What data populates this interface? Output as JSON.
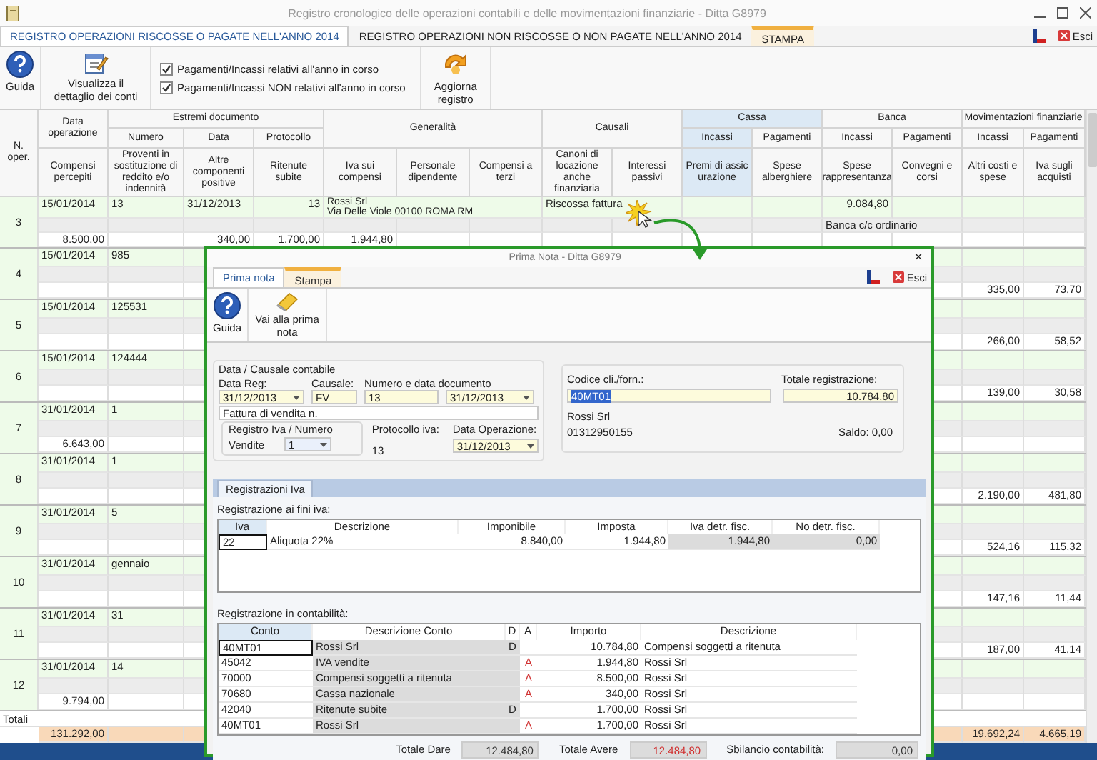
{
  "window": {
    "title": "Registro cronologico delle operazioni contabili e delle movimentazioni finanziarie - Ditta G8979"
  },
  "tabs": [
    {
      "label": "REGISTRO OPERAZIONI RISCOSSE O PAGATE NELL'ANNO 2014",
      "selected": true,
      "highlighted": false
    },
    {
      "label": "REGISTRO OPERAZIONI NON RISCOSSE O NON PAGATE NELL'ANNO 2014",
      "selected": false,
      "highlighted": false
    },
    {
      "label": "STAMPA",
      "selected": false,
      "highlighted": true
    }
  ],
  "exit": "Esci",
  "toolbar": {
    "help": "Guida",
    "details": "Visualizza il dettaglio dei conti",
    "checkboxes": [
      {
        "label": "Pagamenti/Incassi relativi all'anno in corso",
        "checked": true
      },
      {
        "label": "Pagamenti/Incassi NON relativi all'anno in corso",
        "checked": true
      }
    ],
    "refresh": "Aggiorna registro"
  },
  "table": {
    "header": {
      "n_oper": "N. oper.",
      "data_operazione": "Data operazione",
      "groups": [
        {
          "label": "Estremi documento",
          "subheaders": [
            "Numero",
            "Data",
            "Protocollo"
          ]
        },
        {
          "label": "Generalità"
        },
        {
          "label": "Causali"
        },
        {
          "label": "Cassa",
          "subheaders": [
            "Incassi",
            "Pagamenti"
          ]
        },
        {
          "label": "Banca",
          "subheaders": [
            "Incassi",
            "Pagamenti"
          ]
        },
        {
          "label": "Movimentazioni finanziarie",
          "subheaders": [
            "Incassi",
            "Pagamenti"
          ]
        }
      ],
      "columns": [
        {
          "label": "Compensi percepiti",
          "selected": false
        },
        {
          "label": "Proventi in sostituzione di reddito e/o indennità",
          "selected": false
        },
        {
          "label": "Altre componenti positive",
          "selected": false
        },
        {
          "label": "Ritenute subite",
          "selected": false
        },
        {
          "label": "Iva sui compensi",
          "selected": false
        },
        {
          "label": "Personale dipendente",
          "selected": false
        },
        {
          "label": "Compensi a terzi",
          "selected": false
        },
        {
          "label": "Canoni di locazione anche finanziaria",
          "selected": false
        },
        {
          "label": "Interessi passivi",
          "selected": false
        },
        {
          "label": "Premi di assicurazione",
          "selected": true
        },
        {
          "label": "Spese alberghiere",
          "selected": false
        },
        {
          "label": "Spese rappresentanza",
          "selected": false
        },
        {
          "label": "Convegni e corsi",
          "selected": false
        },
        {
          "label": "Altri costi e spese",
          "selected": false
        },
        {
          "label": "Iva sugli acquisti",
          "selected": false
        }
      ]
    },
    "rows": [
      {
        "n": "3",
        "data_operazione": "15/01/2014",
        "numero": "13",
        "data": "31/12/2013",
        "protocollo": "13",
        "generalita": [
          "Rossi Srl",
          "Via Delle Viole 00100 ROMA RM"
        ],
        "causale": "Riscossa fattura",
        "banca_incassi": "9.084,80",
        "banca_note": "Banca c/c ordinario",
        "compensi": "8.500,00",
        "altre_componenti": "340,00",
        "ritenute": "1.700,00",
        "iva_compensi": "1.944,80"
      },
      {
        "n": "4",
        "data_operazione": "15/01/2014",
        "numero": "985",
        "altri_costi": "335,00",
        "iva_acquisti": "73,70"
      },
      {
        "n": "5",
        "data_operazione": "15/01/2014",
        "numero": "125531",
        "altri_costi": "266,00",
        "iva_acquisti": "58,52"
      },
      {
        "n": "6",
        "data_operazione": "15/01/2014",
        "numero": "124444",
        "altri_costi": "139,00",
        "iva_acquisti": "30,58"
      },
      {
        "n": "7",
        "data_operazione": "31/01/2014",
        "numero": "1",
        "compensi": "6.643,00"
      },
      {
        "n": "8",
        "data_operazione": "31/01/2014",
        "numero": "1",
        "altri_costi": "2.190,00",
        "iva_acquisti": "481,80"
      },
      {
        "n": "9",
        "data_operazione": "31/01/2014",
        "numero": "5",
        "altri_costi": "524,16",
        "iva_acquisti": "115,32"
      },
      {
        "n": "10",
        "data_operazione": "31/01/2014",
        "numero": "gennaio",
        "altri_costi": "147,16",
        "iva_acquisti": "11,44"
      },
      {
        "n": "11",
        "data_operazione": "31/01/2014",
        "numero": "31",
        "altri_costi": "187,00",
        "iva_acquisti": "41,14"
      },
      {
        "n": "12",
        "data_operazione": "31/01/2014",
        "numero": "14",
        "compensi": "9.794,00"
      }
    ],
    "totals": {
      "label": "Totali",
      "compensi": "131.292,00",
      "altri_costi": "19.692,24",
      "iva_acquisti": "4.665,19"
    }
  },
  "dialog": {
    "title": "Prima Nota - Ditta G8979",
    "close": "×",
    "tabs": [
      {
        "label": "Prima nota",
        "selected": true,
        "highlighted": false
      },
      {
        "label": "Stampa",
        "selected": false,
        "highlighted": true
      }
    ],
    "exit": "Esci",
    "toolbar": {
      "help": "Guida",
      "goto": "Vai alla prima nota"
    },
    "causale_group": {
      "legend": "Data / Causale contabile",
      "data_reg": {
        "label": "Data Reg:",
        "value": "31/12/2013"
      },
      "causale": {
        "label": "Causale:",
        "value": "FV"
      },
      "documento": {
        "label": "Numero e data documento",
        "numero": "13",
        "data": "31/12/2013"
      },
      "descrizione": "Fattura di vendita n.",
      "registro": {
        "legend": "Registro Iva / Numero",
        "name": "Vendite",
        "numero": "1"
      },
      "protocollo": {
        "label": "Protocollo iva:",
        "value": "13"
      },
      "data_operazione": {
        "label": "Data Operazione:",
        "value": "31/12/2013"
      }
    },
    "cliente": {
      "codice_label": "Codice cli./forn.:",
      "codice": "40MT01",
      "codice_selected": true,
      "totale_label": "Totale registrazione:",
      "totale": "10.784,80",
      "nome": "Rossi Srl",
      "piva": "01312950155",
      "saldo": "Saldo: 0,00"
    },
    "subtabs": [
      {
        "label": "Registrazioni Iva",
        "selected": true
      }
    ],
    "iva": {
      "label": "Registrazione ai fini iva:",
      "columns": [
        "Iva",
        "Descrizione",
        "Imponibile",
        "Imposta",
        "Iva detr. fisc.",
        "No detr. fisc."
      ],
      "rows": [
        [
          "22",
          "Aliquota 22%",
          "8.840,00",
          "1.944,80",
          "1.944,80",
          "0,00"
        ]
      ]
    },
    "contabilita": {
      "label": "Registrazione in contabilità:",
      "columns": [
        "Conto",
        "Descrizione Conto",
        "D",
        "A",
        "Importo",
        "Descrizione"
      ],
      "rows": [
        {
          "conto": "40MT01",
          "descrizione_conto": "Rossi Srl",
          "side": "D",
          "importo": "10.784,80",
          "descrizione": "Compensi soggetti a ritenuta"
        },
        {
          "conto": "45042",
          "descrizione_conto": "IVA vendite",
          "side": "A",
          "importo": "1.944,80",
          "descrizione": "Rossi Srl"
        },
        {
          "conto": "70000",
          "descrizione_conto": "Compensi soggetti a ritenuta",
          "side": "A",
          "importo": "8.500,00",
          "descrizione": "Rossi Srl"
        },
        {
          "conto": "70680",
          "descrizione_conto": "Cassa nazionale",
          "side": "A",
          "importo": "340,00",
          "descrizione": "Rossi Srl"
        },
        {
          "conto": "42040",
          "descrizione_conto": "Ritenute subite",
          "side": "D",
          "importo": "1.700,00",
          "descrizione": "Rossi Srl"
        },
        {
          "conto": "40MT01",
          "descrizione_conto": "Rossi Srl",
          "side": "A",
          "importo": "1.700,00",
          "descrizione": "Rossi Srl"
        }
      ]
    },
    "totals": [
      {
        "label": "Totale Dare",
        "value": "12.484,80",
        "color": "#333333"
      },
      {
        "label": "Totale Avere",
        "value": "12.484,80",
        "color": "#d03030"
      },
      {
        "label": "Sbilancio contabilità:",
        "value": "0,00",
        "color": "#333333"
      }
    ]
  }
}
